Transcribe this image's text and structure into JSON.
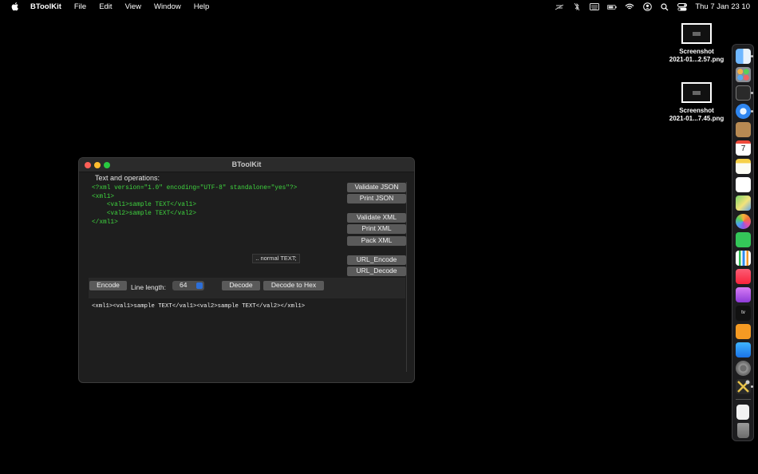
{
  "menubar": {
    "app_name": "BToolKit",
    "menus": [
      "File",
      "Edit",
      "View",
      "Window",
      "Help"
    ],
    "clock": "Thu 7 Jan  23 10"
  },
  "desktop": {
    "files": [
      {
        "line1": "Screenshot",
        "line2": "2021-01...2.57.png"
      },
      {
        "line1": "Screenshot",
        "line2": "2021-01...7.45.png"
      }
    ]
  },
  "window": {
    "title": "BToolKit",
    "section_label": "Text and operations:",
    "input_lines": [
      "<?xml version=\"1.0\" encoding=\"UTF-8\" standalone=\"yes\"?>",
      "<xml1>",
      "    <val1>sample TEXT</val1>",
      "    <val2>sample TEXT</val2>",
      "</xml1>"
    ],
    "tooltip": ".. normal TEXT;",
    "buttons": {
      "validate_json": "Validate JSON",
      "print_json": "Print JSON",
      "validate_xml": "Validate XML",
      "print_xml": "Print XML",
      "pack_xml": "Pack XML",
      "url_encode": "URL_Encode",
      "url_decode": "URL_Decode",
      "encode": "Encode",
      "decode": "Decode",
      "decode_hex": "Decode to Hex"
    },
    "line_length_label": "Line length:",
    "line_length_value": "64",
    "output_text": "<xml1><val1>sample TEXT</val1><val2>sample TEXT</val2></xml1>"
  },
  "colors": {
    "code_green": "#3fd43f",
    "button_gray": "#5a5a5a",
    "close": "#ff5f57",
    "minimize": "#febc2e",
    "zoom": "#28c840"
  },
  "dock_icons": [
    "finder-icon",
    "launchpad-icon",
    "terminal-icon",
    "safari-icon",
    "contacts-icon",
    "calendar-icon",
    "notes-icon",
    "reminders-icon",
    "maps-icon",
    "photos-icon",
    "messages-icon",
    "numbers-icon",
    "music-icon",
    "podcasts-icon",
    "tv-icon",
    "books-icon",
    "app-store-icon",
    "system-preferences-icon",
    "btoolkit-icon",
    "document-icon",
    "trash-icon"
  ]
}
